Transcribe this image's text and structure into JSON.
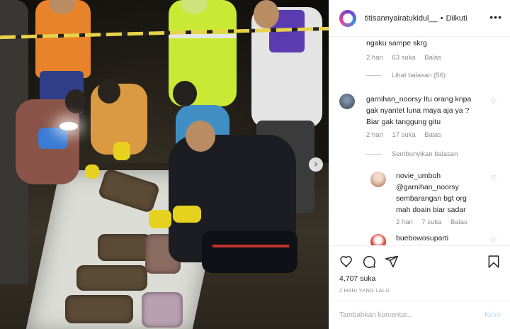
{
  "header": {
    "username": "titisannyairatukidul__",
    "separator": "•",
    "follow_status": "Diikuti",
    "more": "•••"
  },
  "comments": [
    {
      "text": "ngaku sampe skrg",
      "time": "2 hari",
      "likes": "63 suka",
      "reply": "Balas",
      "toggle": "Lihat balasan (56)"
    },
    {
      "username": "garnihan_noorsy",
      "text_line1": "Itu orang knpa",
      "text_line2": "gak nyantet luna maya aja ya ?",
      "text_line3": "Biar gak tanggung gitu",
      "time": "2 hari",
      "likes": "17 suka",
      "reply": "Balas",
      "toggle": "Sembunyikan balasan"
    },
    {
      "username": "novie_umboh",
      "mention": "@garnihan_noorsy",
      "text_line1": "sembarangan bgt org",
      "text_line2": "mah doain biar sadar",
      "time": "2 hari",
      "likes": "7 suka",
      "reply": "Balas"
    },
    {
      "username": "buebowosuparti"
    }
  ],
  "actions": {
    "likes": "4,707 suka",
    "date": "2 HARI YANG LALU"
  },
  "add_comment": {
    "placeholder": "Tambahkan komentar...",
    "send": "Kirim"
  },
  "photo": {
    "next_arrow": "›"
  },
  "colors": {
    "text": "#262626",
    "muted": "#8e8e8e",
    "send_disabled": "#b3dbff",
    "border": "#efefef"
  }
}
